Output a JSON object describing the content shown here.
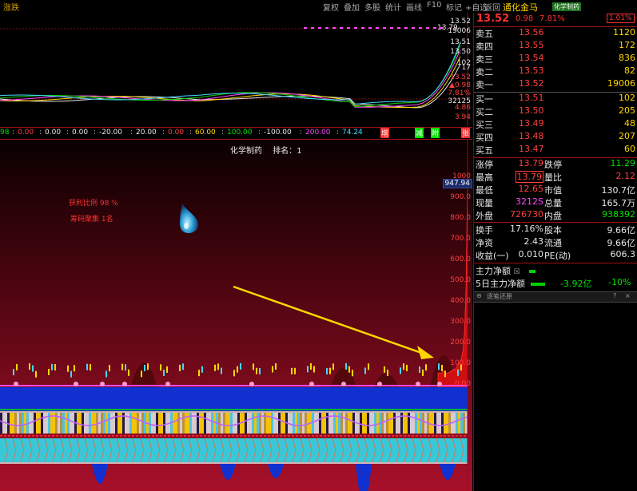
{
  "topbar": {
    "left_title": "涨跌",
    "menus": [
      "复权",
      "叠加",
      "多股",
      "统计",
      "画线",
      "F10",
      "标记",
      "+自选",
      "返回"
    ]
  },
  "price_chart": {
    "left_tag": "涨跌",
    "current_label": "13.79",
    "y_ticks": [
      "13.52",
      "19006",
      "13.51",
      "13.50",
      "102",
      "17",
      "13.52",
      "▲0.98",
      "7.81%",
      "32125",
      "4.86",
      "3.94"
    ]
  },
  "indicator_bar": {
    "items": [
      {
        "text": "98",
        "color": "#00e000"
      },
      {
        "text": "0.00",
        "color": "#ff4040"
      },
      {
        "text": "0.00",
        "color": "#e6e6e6"
      },
      {
        "text": "0.00",
        "color": "#e6e6e6"
      },
      {
        "text": "-20.00",
        "color": "#e6e6e6"
      },
      {
        "text": "20.00",
        "color": "#e6e6e6"
      },
      {
        "text": "0.00",
        "color": "#ff4040"
      },
      {
        "text": "60.00",
        "color": "#ffd700"
      },
      {
        "text": "100.00",
        "color": "#00e000"
      },
      {
        "text": "-100.00",
        "color": "#e6e6e6"
      },
      {
        "text": "200.00",
        "color": "#ff47ff"
      },
      {
        "text": "74.24",
        "color": "#44d7ff"
      }
    ],
    "tabs": [
      "增",
      "减",
      "附",
      "张"
    ]
  },
  "main_chart": {
    "title": "化学制药",
    "rank_label": "排名：",
    "rank_value": "1",
    "legend_profit": "获利比例 98 %",
    "legend_chip": "筹码聚集 1名",
    "current_value_box": "947.94",
    "y_ticks": [
      "1000",
      "900.0",
      "800.0",
      "700.0",
      "600.0",
      "500.0",
      "400.0",
      "300.0",
      "200.0",
      "100.0",
      "0.00"
    ],
    "chart_data": {
      "type": "area",
      "title": "",
      "series": [
        {
          "name": "",
          "values": [
            10,
            12,
            8,
            15,
            20,
            12,
            9,
            14,
            18,
            22,
            30,
            25,
            40,
            55,
            60,
            80,
            120,
            200,
            420,
            947
          ]
        }
      ],
      "ylim": [
        0,
        1000
      ],
      "grid": false,
      "legend": "top-left"
    }
  },
  "quote": {
    "name": "通化金马",
    "board_tag": "化学制药",
    "price": "13.52",
    "change": "0.98",
    "pct": "7.81%",
    "rank_badge": "1.01%",
    "sells": [
      {
        "label": "卖五",
        "price": "13.56",
        "vol": "1120"
      },
      {
        "label": "卖四",
        "price": "13.55",
        "vol": "172"
      },
      {
        "label": "卖三",
        "price": "13.54",
        "vol": "836"
      },
      {
        "label": "卖二",
        "price": "13.53",
        "vol": "82"
      },
      {
        "label": "卖一",
        "price": "13.52",
        "vol": "19006"
      }
    ],
    "buys": [
      {
        "label": "买一",
        "price": "13.51",
        "vol": "102"
      },
      {
        "label": "买二",
        "price": "13.50",
        "vol": "205"
      },
      {
        "label": "买三",
        "price": "13.49",
        "vol": "48"
      },
      {
        "label": "买四",
        "price": "13.48",
        "vol": "207"
      },
      {
        "label": "买五",
        "price": "13.47",
        "vol": "60"
      }
    ],
    "stats": [
      {
        "k1": "涨停",
        "v1": "13.79",
        "k2": "跌停",
        "v2": "11.29",
        "c1": "#ff4040",
        "c2": "#00e000"
      },
      {
        "k1": "最高",
        "v1": "13.79",
        "k2": "量比",
        "v2": "2.12",
        "c1": "#ff4040",
        "c2": "#ff4040"
      },
      {
        "k1": "最低",
        "v1": "12.65",
        "k2": "市值",
        "v2": "130.7亿",
        "c1": "#ff4040",
        "c2": "#e6e6e6"
      },
      {
        "k1": "现量",
        "v1": "3212S",
        "k2": "总量",
        "v2": "165.7万",
        "c1": "#ff47ff",
        "c2": "#e6e6e6"
      },
      {
        "k1": "外盘",
        "v1": "726730",
        "k2": "内盘",
        "v2": "938392",
        "c1": "#ff4040",
        "c2": "#00e000"
      }
    ],
    "stats2": [
      {
        "k1": "换手",
        "v1": "17.16%",
        "k2": "股本",
        "v2": "9.66亿"
      },
      {
        "k1": "净资",
        "v1": "2.43",
        "k2": "流通",
        "v2": "9.66亿"
      },
      {
        "k1": "收益(一)",
        "v1": "0.010",
        "k2": "PE(动)",
        "v2": "606.3"
      }
    ],
    "main_net_label": "主力净额",
    "main_net_icon": "☒",
    "five_day_label": "5日主力净额",
    "five_day_value": "-3.92亿",
    "five_day_pct": "-10%",
    "chip_panel_title": "逐笔还原",
    "chip_panel_help": "?",
    "chip_panel_close": "×"
  }
}
